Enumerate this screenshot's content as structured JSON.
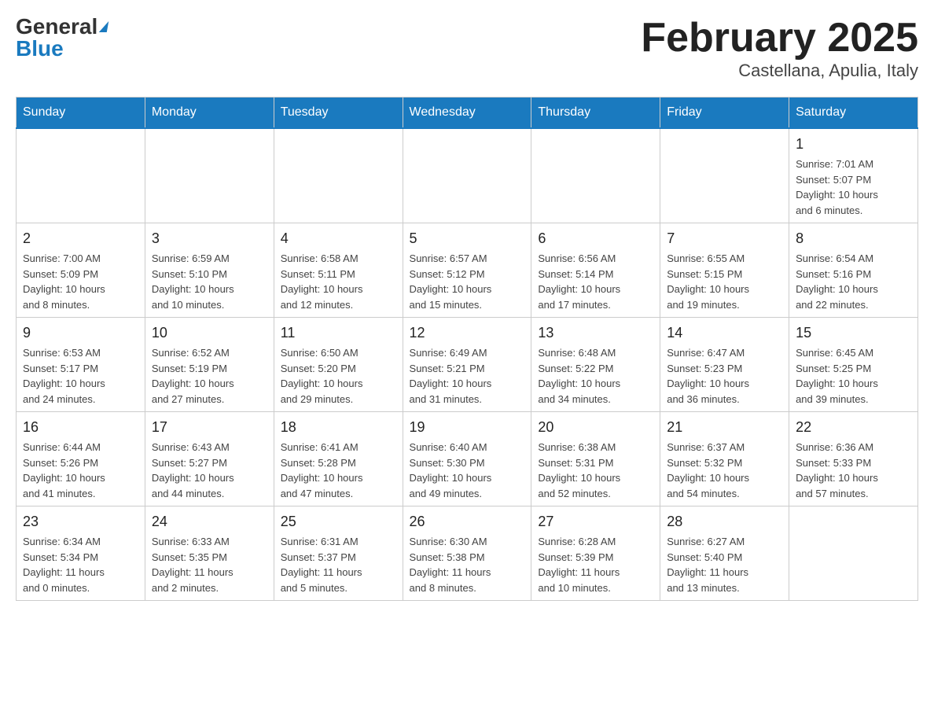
{
  "logo": {
    "general": "General",
    "blue": "Blue"
  },
  "title": "February 2025",
  "location": "Castellana, Apulia, Italy",
  "weekdays": [
    "Sunday",
    "Monday",
    "Tuesday",
    "Wednesday",
    "Thursday",
    "Friday",
    "Saturday"
  ],
  "weeks": [
    [
      {
        "day": "",
        "info": ""
      },
      {
        "day": "",
        "info": ""
      },
      {
        "day": "",
        "info": ""
      },
      {
        "day": "",
        "info": ""
      },
      {
        "day": "",
        "info": ""
      },
      {
        "day": "",
        "info": ""
      },
      {
        "day": "1",
        "info": "Sunrise: 7:01 AM\nSunset: 5:07 PM\nDaylight: 10 hours\nand 6 minutes."
      }
    ],
    [
      {
        "day": "2",
        "info": "Sunrise: 7:00 AM\nSunset: 5:09 PM\nDaylight: 10 hours\nand 8 minutes."
      },
      {
        "day": "3",
        "info": "Sunrise: 6:59 AM\nSunset: 5:10 PM\nDaylight: 10 hours\nand 10 minutes."
      },
      {
        "day": "4",
        "info": "Sunrise: 6:58 AM\nSunset: 5:11 PM\nDaylight: 10 hours\nand 12 minutes."
      },
      {
        "day": "5",
        "info": "Sunrise: 6:57 AM\nSunset: 5:12 PM\nDaylight: 10 hours\nand 15 minutes."
      },
      {
        "day": "6",
        "info": "Sunrise: 6:56 AM\nSunset: 5:14 PM\nDaylight: 10 hours\nand 17 minutes."
      },
      {
        "day": "7",
        "info": "Sunrise: 6:55 AM\nSunset: 5:15 PM\nDaylight: 10 hours\nand 19 minutes."
      },
      {
        "day": "8",
        "info": "Sunrise: 6:54 AM\nSunset: 5:16 PM\nDaylight: 10 hours\nand 22 minutes."
      }
    ],
    [
      {
        "day": "9",
        "info": "Sunrise: 6:53 AM\nSunset: 5:17 PM\nDaylight: 10 hours\nand 24 minutes."
      },
      {
        "day": "10",
        "info": "Sunrise: 6:52 AM\nSunset: 5:19 PM\nDaylight: 10 hours\nand 27 minutes."
      },
      {
        "day": "11",
        "info": "Sunrise: 6:50 AM\nSunset: 5:20 PM\nDaylight: 10 hours\nand 29 minutes."
      },
      {
        "day": "12",
        "info": "Sunrise: 6:49 AM\nSunset: 5:21 PM\nDaylight: 10 hours\nand 31 minutes."
      },
      {
        "day": "13",
        "info": "Sunrise: 6:48 AM\nSunset: 5:22 PM\nDaylight: 10 hours\nand 34 minutes."
      },
      {
        "day": "14",
        "info": "Sunrise: 6:47 AM\nSunset: 5:23 PM\nDaylight: 10 hours\nand 36 minutes."
      },
      {
        "day": "15",
        "info": "Sunrise: 6:45 AM\nSunset: 5:25 PM\nDaylight: 10 hours\nand 39 minutes."
      }
    ],
    [
      {
        "day": "16",
        "info": "Sunrise: 6:44 AM\nSunset: 5:26 PM\nDaylight: 10 hours\nand 41 minutes."
      },
      {
        "day": "17",
        "info": "Sunrise: 6:43 AM\nSunset: 5:27 PM\nDaylight: 10 hours\nand 44 minutes."
      },
      {
        "day": "18",
        "info": "Sunrise: 6:41 AM\nSunset: 5:28 PM\nDaylight: 10 hours\nand 47 minutes."
      },
      {
        "day": "19",
        "info": "Sunrise: 6:40 AM\nSunset: 5:30 PM\nDaylight: 10 hours\nand 49 minutes."
      },
      {
        "day": "20",
        "info": "Sunrise: 6:38 AM\nSunset: 5:31 PM\nDaylight: 10 hours\nand 52 minutes."
      },
      {
        "day": "21",
        "info": "Sunrise: 6:37 AM\nSunset: 5:32 PM\nDaylight: 10 hours\nand 54 minutes."
      },
      {
        "day": "22",
        "info": "Sunrise: 6:36 AM\nSunset: 5:33 PM\nDaylight: 10 hours\nand 57 minutes."
      }
    ],
    [
      {
        "day": "23",
        "info": "Sunrise: 6:34 AM\nSunset: 5:34 PM\nDaylight: 11 hours\nand 0 minutes."
      },
      {
        "day": "24",
        "info": "Sunrise: 6:33 AM\nSunset: 5:35 PM\nDaylight: 11 hours\nand 2 minutes."
      },
      {
        "day": "25",
        "info": "Sunrise: 6:31 AM\nSunset: 5:37 PM\nDaylight: 11 hours\nand 5 minutes."
      },
      {
        "day": "26",
        "info": "Sunrise: 6:30 AM\nSunset: 5:38 PM\nDaylight: 11 hours\nand 8 minutes."
      },
      {
        "day": "27",
        "info": "Sunrise: 6:28 AM\nSunset: 5:39 PM\nDaylight: 11 hours\nand 10 minutes."
      },
      {
        "day": "28",
        "info": "Sunrise: 6:27 AM\nSunset: 5:40 PM\nDaylight: 11 hours\nand 13 minutes."
      },
      {
        "day": "",
        "info": ""
      }
    ]
  ]
}
